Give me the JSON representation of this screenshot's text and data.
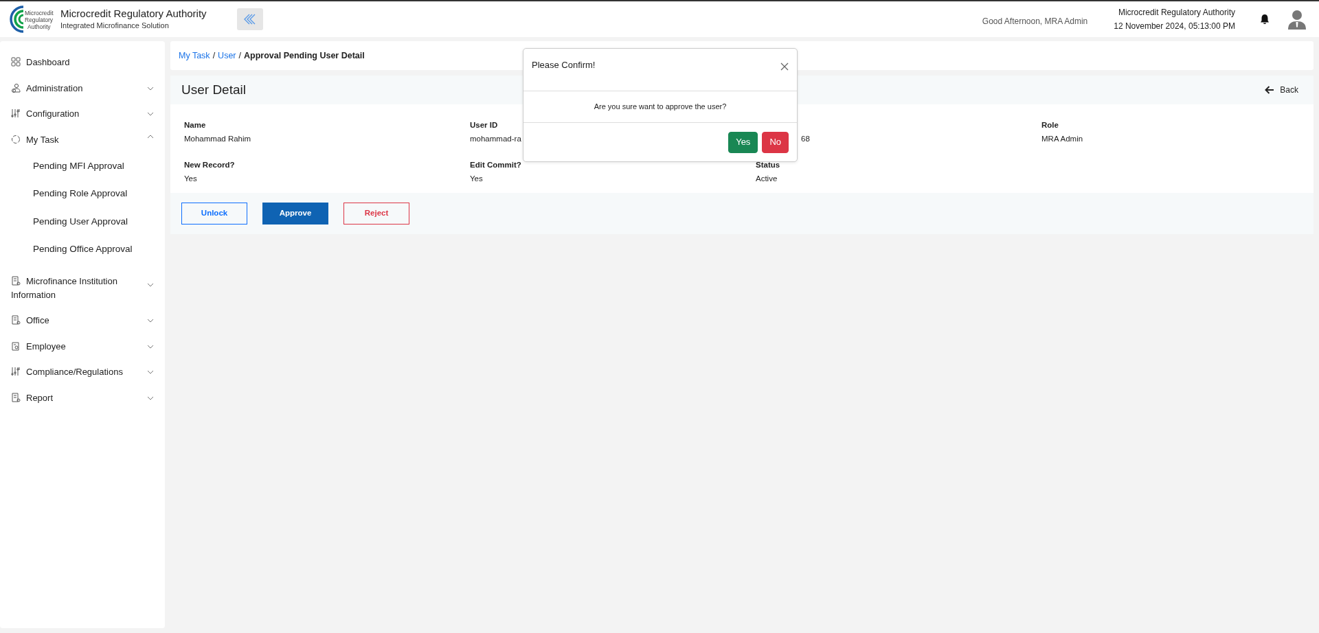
{
  "header": {
    "logo_text": [
      "Microcredit",
      "Regulatory",
      "Authority"
    ],
    "title": "Microcredit Regulatory Authority",
    "subtitle": "Integrated Microfinance Solution",
    "greeting": "Good Afternoon, MRA Admin",
    "org": "Microcredit Regulatory Authority",
    "datetime": "12 November 2024, 05:13:00 PM"
  },
  "sidebar": {
    "items": [
      {
        "label": "Dashboard"
      },
      {
        "label": "Administration",
        "expanded": false
      },
      {
        "label": "Configuration",
        "expanded": false
      },
      {
        "label": "My Task",
        "expanded": true,
        "children": [
          {
            "label": "Pending MFI Approval"
          },
          {
            "label": "Pending Role Approval"
          },
          {
            "label": "Pending User Approval"
          },
          {
            "label": "Pending Office Approval"
          }
        ]
      },
      {
        "label": "Microfinance Institution Information",
        "expanded": false
      },
      {
        "label": "Office",
        "expanded": false
      },
      {
        "label": "Employee",
        "expanded": false
      },
      {
        "label": "Compliance/Regulations",
        "expanded": false
      },
      {
        "label": "Report",
        "expanded": false
      }
    ]
  },
  "breadcrumb_separator": "/",
  "breadcrumb": [
    {
      "label": "My Task",
      "link": true
    },
    {
      "label": "User",
      "link": true
    },
    {
      "label": "Approval Pending User Detail",
      "link": false
    }
  ],
  "detail": {
    "title": "User Detail",
    "back": "Back",
    "fields": [
      {
        "label": "Name",
        "value": "Mohammad Rahim"
      },
      {
        "label": "User ID",
        "value": "mohammad-ra"
      },
      {
        "value": "68"
      },
      {
        "label": "Role",
        "value": "MRA Admin"
      },
      {
        "label": "New Record?",
        "value": "Yes"
      },
      {
        "label": "Edit Commit?",
        "value": "Yes"
      },
      {
        "label": "Status",
        "value": "Active"
      }
    ],
    "buttons": [
      {
        "label": "Unlock",
        "kind": "outline-primary"
      },
      {
        "label": "Approve",
        "kind": "primary"
      },
      {
        "label": "Reject",
        "kind": "outline-danger"
      }
    ]
  },
  "modal": {
    "title": "Please Confirm!",
    "message": "Are you sure want to approve the user?",
    "buttons": [
      {
        "label": "Yes",
        "kind": "success"
      },
      {
        "label": "No",
        "kind": "danger"
      }
    ]
  }
}
